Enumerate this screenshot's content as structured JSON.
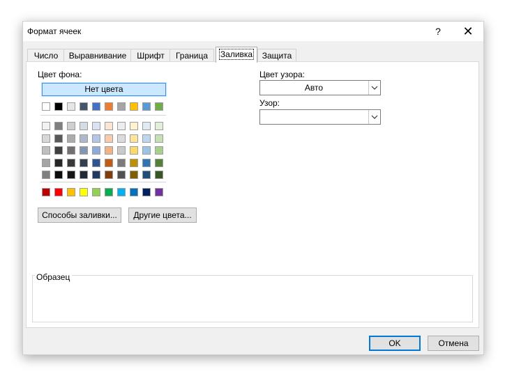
{
  "dialog": {
    "title": "Формат ячеек",
    "help_label": "?",
    "close_label": "✕"
  },
  "tabs": [
    {
      "label": "Число",
      "active": false
    },
    {
      "label": "Выравнивание",
      "active": false
    },
    {
      "label": "Шрифт",
      "active": false
    },
    {
      "label": "Граница",
      "active": false
    },
    {
      "label": "Заливка",
      "active": true
    },
    {
      "label": "Защита",
      "active": false
    }
  ],
  "fill": {
    "background_label": "Цвет фона:",
    "no_color_label": "Нет цвета",
    "fill_effects_label": "Способы заливки...",
    "more_colors_label": "Другие цвета...",
    "pattern_color_label": "Цвет узора:",
    "pattern_color_value": "Авто",
    "pattern_style_label": "Узор:",
    "pattern_style_value": "",
    "sample_label": "Образец"
  },
  "palette": {
    "theme_top": [
      "#ffffff",
      "#000000",
      "#e7e6e6",
      "#44546a",
      "#4472c4",
      "#ed7d31",
      "#a5a5a5",
      "#ffc000",
      "#5b9bd5",
      "#70ad47"
    ],
    "theme_shades": [
      [
        "#f2f2f2",
        "#7f7f7f",
        "#d0cece",
        "#d6dce4",
        "#d9e2f3",
        "#fbe5d5",
        "#ededed",
        "#fff2cc",
        "#deebf6",
        "#e2efd9"
      ],
      [
        "#d8d8d8",
        "#595959",
        "#aeabab",
        "#adb9ca",
        "#b4c6e7",
        "#f7cbac",
        "#dbdbdb",
        "#fee599",
        "#bdd7ee",
        "#c5e0b3"
      ],
      [
        "#bfbfbf",
        "#3f3f3f",
        "#757070",
        "#8496b0",
        "#8eaadb",
        "#f4b183",
        "#c9c9c9",
        "#ffd965",
        "#9dc3e6",
        "#a8d08d"
      ],
      [
        "#a5a5a5",
        "#262626",
        "#3a3838",
        "#323f4f",
        "#2f5496",
        "#c55a11",
        "#7b7b7b",
        "#bf8f00",
        "#2e75b5",
        "#538135"
      ],
      [
        "#7f7f7f",
        "#0c0c0c",
        "#171616",
        "#222a35",
        "#1f3864",
        "#833c0b",
        "#525252",
        "#7f5f00",
        "#1e4e79",
        "#375623"
      ]
    ],
    "standard": [
      "#c00000",
      "#ff0000",
      "#ffc000",
      "#ffff00",
      "#92d050",
      "#00b050",
      "#00b0f0",
      "#0070c0",
      "#002060",
      "#7030a0"
    ]
  },
  "footer": {
    "ok_label": "OK",
    "cancel_label": "Отмена"
  }
}
